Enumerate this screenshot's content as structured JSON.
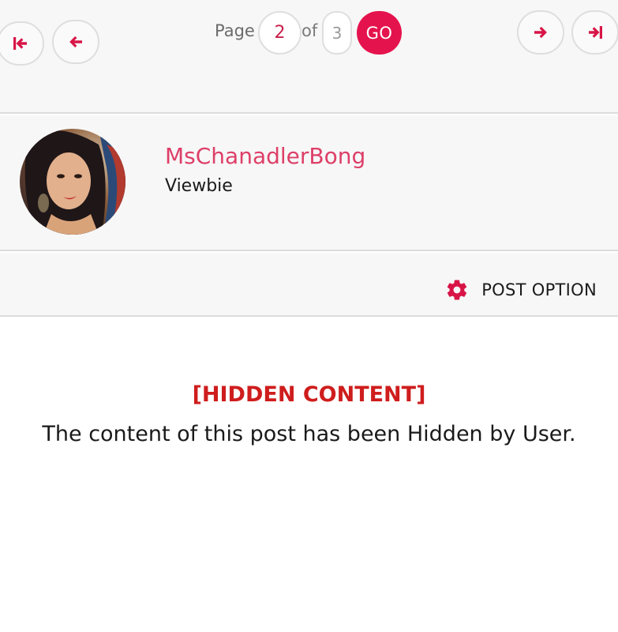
{
  "pagination": {
    "page_label": "Page",
    "current_page": "2",
    "of_label": "of",
    "total_pages": "3",
    "go_label": "GO"
  },
  "profile": {
    "username": "MsChanadlerBong",
    "role": "Viewbie"
  },
  "post_options": {
    "label": "POST OPTION"
  },
  "content": {
    "hidden_title": "[HIDDEN CONTENT]",
    "hidden_message": "The content of this post has been Hidden by User."
  },
  "colors": {
    "accent": "#e5134d",
    "username": "#dd3f68",
    "hidden_title": "#cf1d1d"
  },
  "icons": {
    "first": "first-page-icon",
    "prev": "arrow-left-icon",
    "next": "arrow-right-icon",
    "last": "last-page-icon",
    "options": "gear-icon"
  }
}
